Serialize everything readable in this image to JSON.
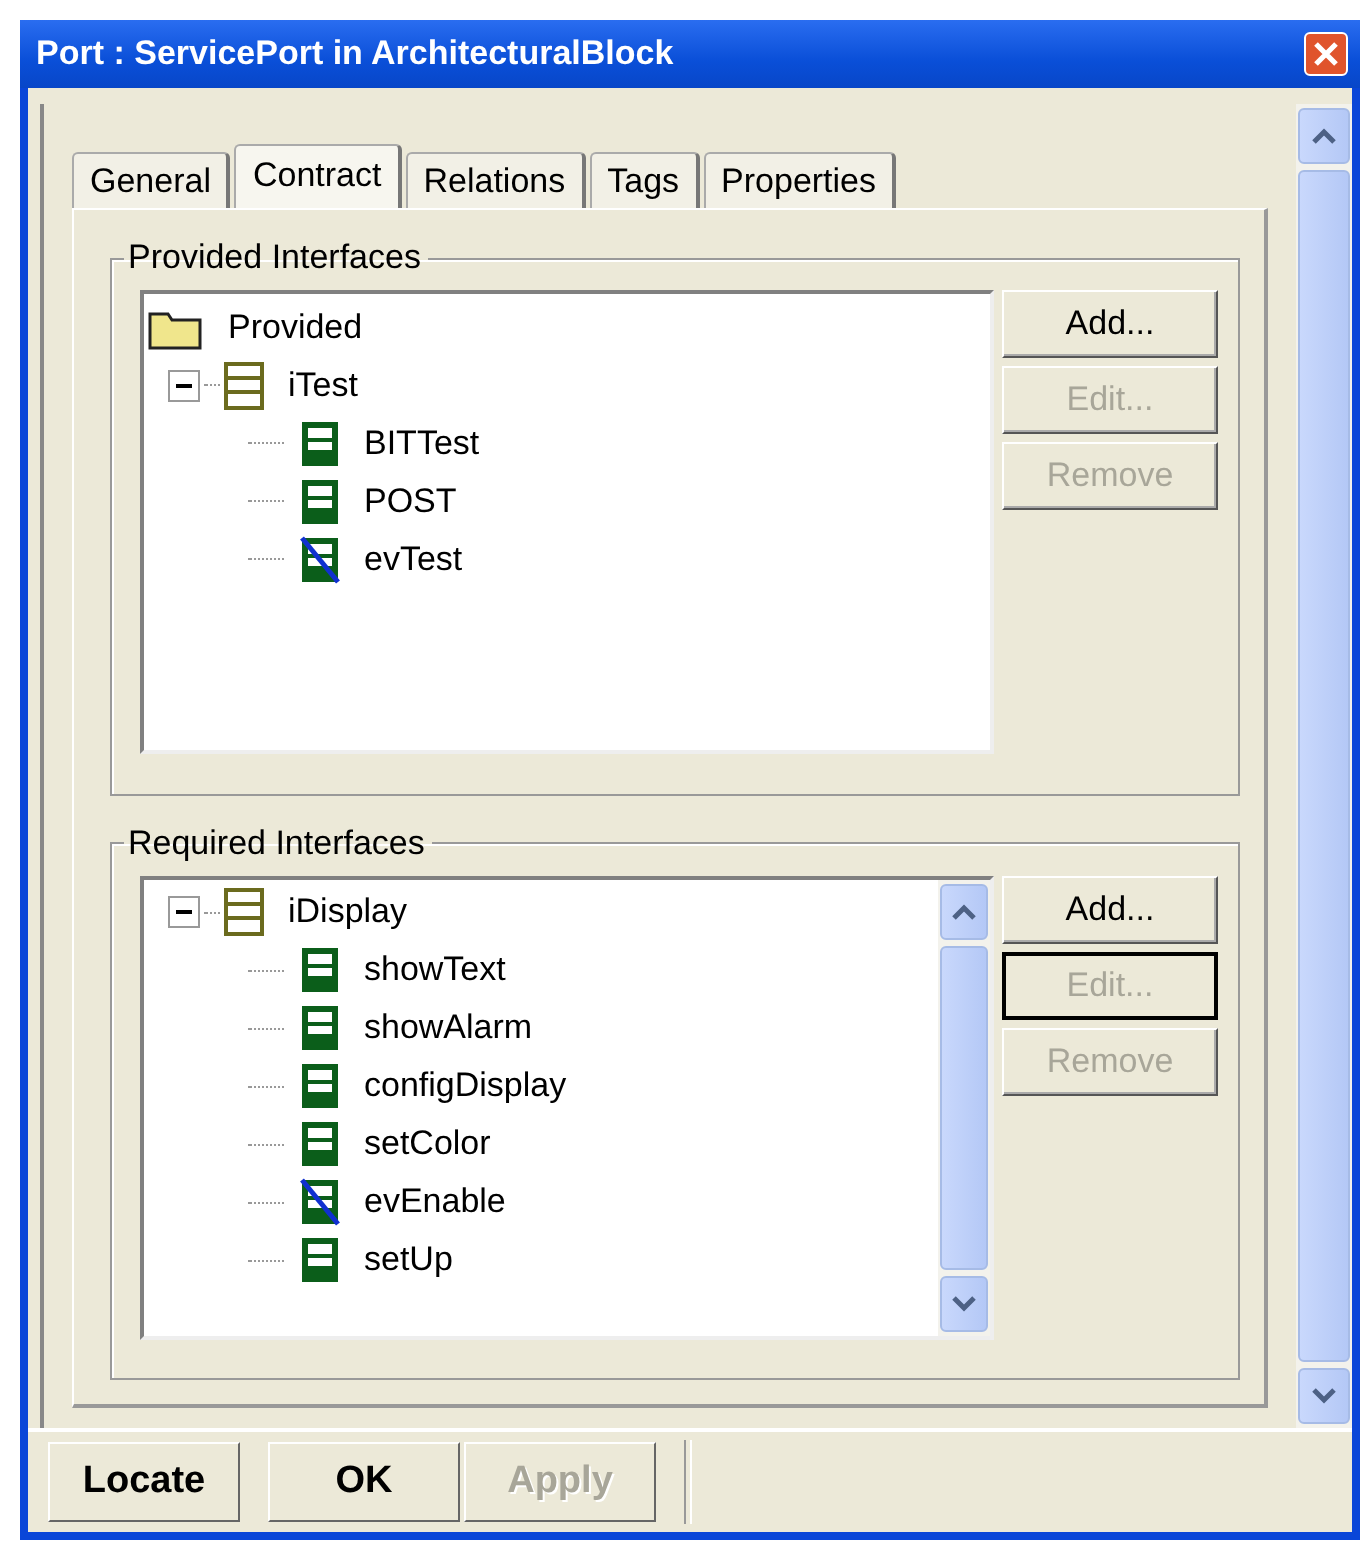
{
  "window": {
    "title": "Port : ServicePort in ArchitecturalBlock"
  },
  "tabs": [
    {
      "label": "General",
      "selected": false
    },
    {
      "label": "Contract",
      "selected": true
    },
    {
      "label": "Relations",
      "selected": false
    },
    {
      "label": "Tags",
      "selected": false
    },
    {
      "label": "Properties",
      "selected": false
    }
  ],
  "groups": [
    {
      "title": "Provided Interfaces",
      "has_scrollbar": false,
      "tree": [
        {
          "kind": "folder",
          "label": "Provided"
        },
        {
          "kind": "interface",
          "label": "iTest",
          "expanded": true,
          "children": [
            {
              "kind": "operation",
              "label": "BITTest"
            },
            {
              "kind": "operation",
              "label": "POST"
            },
            {
              "kind": "event",
              "label": "evTest"
            }
          ]
        }
      ],
      "buttons": [
        {
          "label": "Add...",
          "disabled": false,
          "focused": false
        },
        {
          "label": "Edit...",
          "disabled": true,
          "focused": false
        },
        {
          "label": "Remove",
          "disabled": true,
          "focused": false
        }
      ]
    },
    {
      "title": "Required Interfaces",
      "has_scrollbar": true,
      "tree": [
        {
          "kind": "interface",
          "label": "iDisplay",
          "expanded": true,
          "children": [
            {
              "kind": "operation",
              "label": "showText"
            },
            {
              "kind": "operation",
              "label": "showAlarm"
            },
            {
              "kind": "operation",
              "label": "configDisplay"
            },
            {
              "kind": "operation",
              "label": "setColor"
            },
            {
              "kind": "event",
              "label": "evEnable"
            },
            {
              "kind": "operation",
              "label": "setUp"
            }
          ]
        }
      ],
      "buttons": [
        {
          "label": "Add...",
          "disabled": false,
          "focused": false
        },
        {
          "label": "Edit...",
          "disabled": true,
          "focused": true
        },
        {
          "label": "Remove",
          "disabled": true,
          "focused": false
        }
      ]
    }
  ],
  "footer_buttons": [
    {
      "label": "Locate",
      "disabled": false
    },
    {
      "label": "OK",
      "disabled": false
    },
    {
      "label": "Apply",
      "disabled": true
    }
  ]
}
